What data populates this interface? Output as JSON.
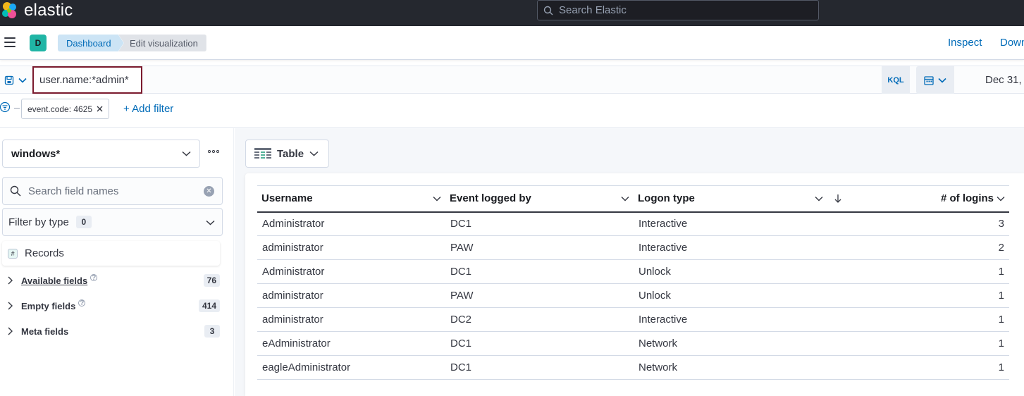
{
  "app": {
    "brand": "elastic",
    "global_search_placeholder": "Search Elastic"
  },
  "nav": {
    "space_initial": "D",
    "breadcrumbs": [
      "Dashboard",
      "Edit visualization"
    ],
    "links": [
      "Inspect",
      "Down"
    ]
  },
  "query": {
    "value": "user.name:*admin*",
    "language": "KQL",
    "date_start": "Dec 31, :"
  },
  "filters": {
    "pills": [
      "event.code: 4625"
    ],
    "add_label": "+ Add filter"
  },
  "sidebar": {
    "index_pattern": "windows*",
    "search_placeholder": "Search field names",
    "filter_type_label": "Filter by type",
    "filter_type_count": "0",
    "records_label": "Records",
    "groups": [
      {
        "label": "Available fields",
        "count": "76"
      },
      {
        "label": "Empty fields",
        "count": "414"
      },
      {
        "label": "Meta fields",
        "count": "3"
      }
    ]
  },
  "workspace": {
    "chart_type": "Table"
  },
  "table": {
    "columns": [
      "Username",
      "Event logged by",
      "Logon type",
      "# of logins"
    ],
    "rows": [
      [
        "Administrator",
        "DC1",
        "Interactive",
        "3"
      ],
      [
        "administrator",
        "PAW",
        "Interactive",
        "2"
      ],
      [
        "Administrator",
        "DC1",
        "Unlock",
        "1"
      ],
      [
        "administrator",
        "PAW",
        "Unlock",
        "1"
      ],
      [
        "administrator",
        "DC2",
        "Interactive",
        "1"
      ],
      [
        "eAdministrator",
        "DC1",
        "Network",
        "1"
      ],
      [
        "eagleAdministrator",
        "DC1",
        "Network",
        "1"
      ]
    ]
  },
  "colors": {
    "header_bg": "#25282f",
    "link": "#006bb8",
    "query_highlight": "#7b1b2e",
    "space_avatar": "#20b5a5"
  },
  "icons": [
    "elastic-logo-icon",
    "search-icon",
    "menu-icon",
    "save-query-icon",
    "chevron-down-icon",
    "calendar-icon",
    "filter-icon",
    "close-icon",
    "more-icon",
    "clear-icon",
    "hash-icon",
    "chevron-right-icon",
    "help-icon",
    "table-icon",
    "sort-down-icon"
  ]
}
